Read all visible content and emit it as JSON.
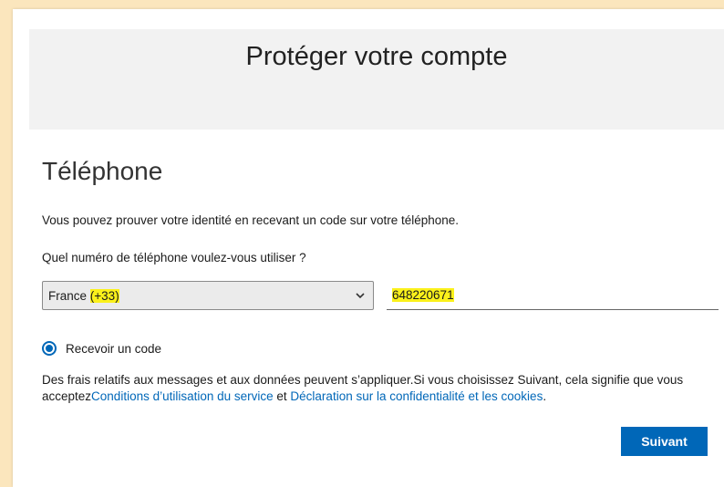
{
  "header": {
    "title": "Protéger votre compte"
  },
  "section": {
    "title": "Téléphone"
  },
  "texts": {
    "intro": "Vous pouvez prouver votre identité en recevant un code sur votre téléphone.",
    "question": "Quel numéro de téléphone voulez-vous utiliser ?"
  },
  "country_select": {
    "country": "France",
    "code": "(+33)"
  },
  "phone_input": {
    "value": "648220671"
  },
  "radio": {
    "label": "Recevoir un code",
    "checked": true
  },
  "note": {
    "text_before": "Des frais relatifs aux messages et aux données peuvent s’appliquer.Si vous choisissez Suivant, cela signifie que vous acceptez",
    "link_terms": "Conditions d’utilisation du service",
    "and": " et ",
    "link_privacy": "Déclaration sur la confidentialité et les cookies",
    "period": "."
  },
  "button": {
    "label": "Suivant"
  },
  "colors": {
    "accent": "#0067b8",
    "highlight": "#fbf11b",
    "header_bg": "#f2f2f2",
    "outer_bg": "#fbe6bd"
  },
  "icons": {
    "select_chevron": "chevron-down-icon"
  }
}
